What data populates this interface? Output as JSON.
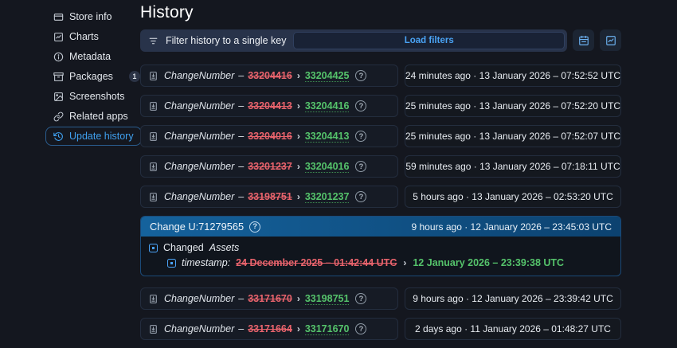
{
  "header": {
    "title": "History"
  },
  "sidebar": {
    "items": [
      {
        "label": "Store info",
        "icon": "storefront-icon"
      },
      {
        "label": "Charts",
        "icon": "chart-icon"
      },
      {
        "label": "Metadata",
        "icon": "info-icon"
      },
      {
        "label": "Packages",
        "icon": "packages-icon",
        "badge": "1"
      },
      {
        "label": "Screenshots",
        "icon": "screenshots-icon"
      },
      {
        "label": "Related apps",
        "icon": "link-icon"
      },
      {
        "label": "Update history",
        "icon": "history-icon",
        "active": true
      }
    ]
  },
  "filter_bar": {
    "label": "Filter history to a single key",
    "load_button": "Load filters"
  },
  "labels": {
    "dash": "–",
    "arrow": "›",
    "question_mark": "?"
  },
  "rows": [
    {
      "key": "ChangeNumber",
      "old": "33204416",
      "new": "33204425",
      "time_label": "24 minutes ago · 13 January 2026 – 07:52:52 UTC"
    },
    {
      "key": "ChangeNumber",
      "old": "33204413",
      "new": "33204416",
      "time_label": "25 minutes ago · 13 January 2026 – 07:52:20 UTC"
    },
    {
      "key": "ChangeNumber",
      "old": "33204016",
      "new": "33204413",
      "time_label": "25 minutes ago · 13 January 2026 – 07:52:07 UTC"
    },
    {
      "key": "ChangeNumber",
      "old": "33201237",
      "new": "33204016",
      "time_label": "59 minutes ago · 13 January 2026 – 07:18:11 UTC"
    },
    {
      "key": "ChangeNumber",
      "old": "33198751",
      "new": "33201237",
      "time_label": "5 hours ago · 13 January 2026 – 02:53:20 UTC"
    },
    {
      "key": "ChangeNumber",
      "old": "33171670",
      "new": "33198751",
      "time_label": "9 hours ago · 12 January 2026 – 23:39:42 UTC"
    },
    {
      "key": "ChangeNumber",
      "old": "33171664",
      "new": "33171670",
      "time_label": "2 days ago · 11 January 2026 – 01:48:27 UTC"
    }
  ],
  "change_section": {
    "title": "Change U:71279565",
    "time_label": "9 hours ago · 12 January 2026 – 23:45:03 UTC",
    "changed_label": "Changed",
    "changed_target": "Assets",
    "diff_key": "timestamp:",
    "old_value": "24 December 2025 – 01:42:44 UTC",
    "new_value": "12 January 2026 – 23:39:38 UTC"
  },
  "colors": {
    "background": "#14171f",
    "accent_blue": "#3fa0ef",
    "removed_red": "#e8636c",
    "added_green": "#55c36b",
    "header_gradient_start": "#15629c",
    "header_gradient_end": "#0c4270"
  }
}
